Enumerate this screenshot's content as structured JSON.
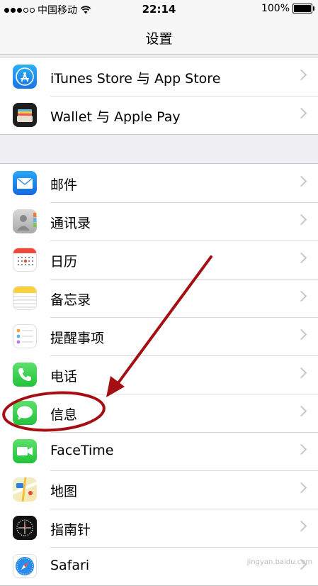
{
  "status_bar": {
    "carrier": "中国移动",
    "time": "22:14",
    "battery": "100%",
    "battery_level": 1.0
  },
  "navbar": {
    "title": "设置"
  },
  "groups": [
    {
      "items": [
        {
          "label": "iTunes Store 与 App Store",
          "icon": "app-store-icon"
        },
        {
          "label": "Wallet 与 Apple Pay",
          "icon": "wallet-icon"
        }
      ]
    },
    {
      "items": [
        {
          "label": "邮件",
          "icon": "mail-icon"
        },
        {
          "label": "通讯录",
          "icon": "contacts-icon"
        },
        {
          "label": "日历",
          "icon": "calendar-icon"
        },
        {
          "label": "备忘录",
          "icon": "notes-icon"
        },
        {
          "label": "提醒事项",
          "icon": "reminders-icon"
        },
        {
          "label": "电话",
          "icon": "phone-icon"
        },
        {
          "label": "信息",
          "icon": "messages-icon"
        },
        {
          "label": "FaceTime",
          "icon": "facetime-icon"
        },
        {
          "label": "地图",
          "icon": "maps-icon"
        },
        {
          "label": "指南针",
          "icon": "compass-icon"
        },
        {
          "label": "Safari",
          "icon": "safari-icon"
        }
      ]
    }
  ],
  "annotation": {
    "color": "#a50f14",
    "highlighted_item": "信息"
  },
  "watermark": "jingyan.baidu.com"
}
